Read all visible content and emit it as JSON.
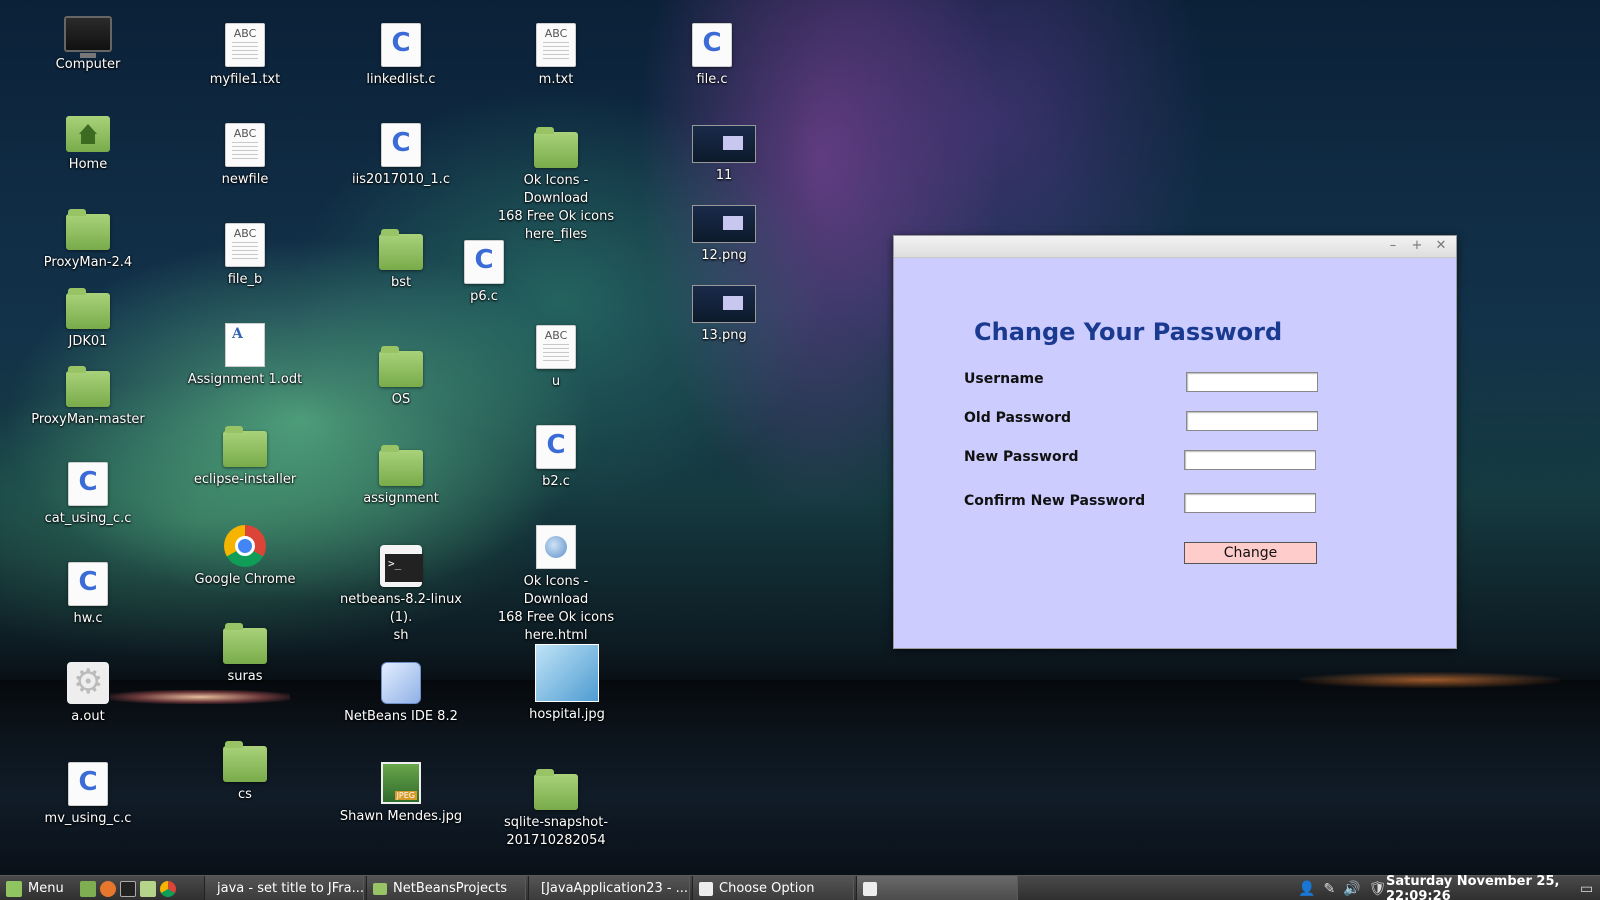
{
  "desktop": {
    "icons": [
      {
        "label": "Computer",
        "icon": "computer-icon"
      },
      {
        "label": "Home",
        "icon": "home-folder-icon"
      },
      {
        "label": "ProxyMan-2.4",
        "icon": "folder-icon"
      },
      {
        "label": "JDK01",
        "icon": "folder-icon"
      },
      {
        "label": "ProxyMan-master",
        "icon": "folder-icon"
      },
      {
        "label": "cat_using_c.c",
        "icon": "c-file-icon"
      },
      {
        "label": "hw.c",
        "icon": "c-file-icon"
      },
      {
        "label": "a.out",
        "icon": "executable-icon"
      },
      {
        "label": "mv_using_c.c",
        "icon": "c-file-icon"
      },
      {
        "label": "myfile1.txt",
        "icon": "text-file-icon"
      },
      {
        "label": "newfile",
        "icon": "text-file-icon"
      },
      {
        "label": "file_b",
        "icon": "text-file-icon"
      },
      {
        "label": "Assignment 1.odt",
        "icon": "document-icon"
      },
      {
        "label": "eclipse-installer",
        "icon": "folder-icon"
      },
      {
        "label": "Google Chrome",
        "icon": "chrome-icon"
      },
      {
        "label": "suras",
        "icon": "folder-icon"
      },
      {
        "label": "cs",
        "icon": "folder-icon"
      },
      {
        "label": "linkedlist.c",
        "icon": "c-file-icon"
      },
      {
        "label": "iis2017010_1.c",
        "icon": "c-file-icon"
      },
      {
        "label": "bst",
        "icon": "folder-icon"
      },
      {
        "label": "OS",
        "icon": "folder-icon"
      },
      {
        "label": "assignment",
        "icon": "folder-icon"
      },
      {
        "label": "netbeans-8.2-linux (1).\nsh",
        "icon": "terminal-script-icon"
      },
      {
        "label": "NetBeans IDE 8.2",
        "icon": "netbeans-cube-icon"
      },
      {
        "label": "Shawn Mendes.jpg",
        "icon": "jpeg-image-icon"
      },
      {
        "label": "p6.c",
        "icon": "c-file-icon"
      },
      {
        "label": "m.txt",
        "icon": "text-file-icon"
      },
      {
        "label": "Ok Icons - Download\n168 Free Ok icons\nhere_files",
        "icon": "folder-icon"
      },
      {
        "label": "u",
        "icon": "text-file-icon"
      },
      {
        "label": "b2.c",
        "icon": "c-file-icon"
      },
      {
        "label": "Ok Icons - Download\n168 Free Ok icons\nhere.html",
        "icon": "html-globe-icon"
      },
      {
        "label": "hospital.jpg",
        "icon": "image-thumbnail-icon"
      },
      {
        "label": "sqlite-snapshot-\n201710282054",
        "icon": "folder-icon"
      },
      {
        "label": "file.c",
        "icon": "c-file-icon"
      },
      {
        "label": "11",
        "icon": "image-thumbnail-icon"
      },
      {
        "label": "12.png",
        "icon": "image-thumbnail-icon"
      },
      {
        "label": "13.png",
        "icon": "image-thumbnail-icon"
      }
    ],
    "icon_text": {
      "abc": "ABC",
      "c": "C"
    }
  },
  "window": {
    "controls": {
      "minimize": "–",
      "maximize": "+",
      "close": "✕"
    },
    "title": "Change Your Password",
    "fields": [
      {
        "label": "Username",
        "value": ""
      },
      {
        "label": "Old Password",
        "value": ""
      },
      {
        "label": "New Password",
        "value": ""
      },
      {
        "label": "Confirm  New Password",
        "value": ""
      }
    ],
    "button": "Change",
    "colors": {
      "background": "#ccccff",
      "title": "#1a3a8f",
      "button": "#ffcccc"
    }
  },
  "taskbar": {
    "menu_label": "Menu",
    "tasks": [
      {
        "label": "java - set title to JFra...",
        "icon": "chrome-icon"
      },
      {
        "label": "NetBeansProjects",
        "icon": "folder-icon"
      },
      {
        "label": "[JavaApplication23 - ...",
        "icon": "netbeans-icon"
      },
      {
        "label": "Choose Option",
        "icon": "java-icon"
      },
      {
        "label": "",
        "icon": "java-icon"
      }
    ],
    "clock": "Saturday November 25, 22:09:26"
  }
}
